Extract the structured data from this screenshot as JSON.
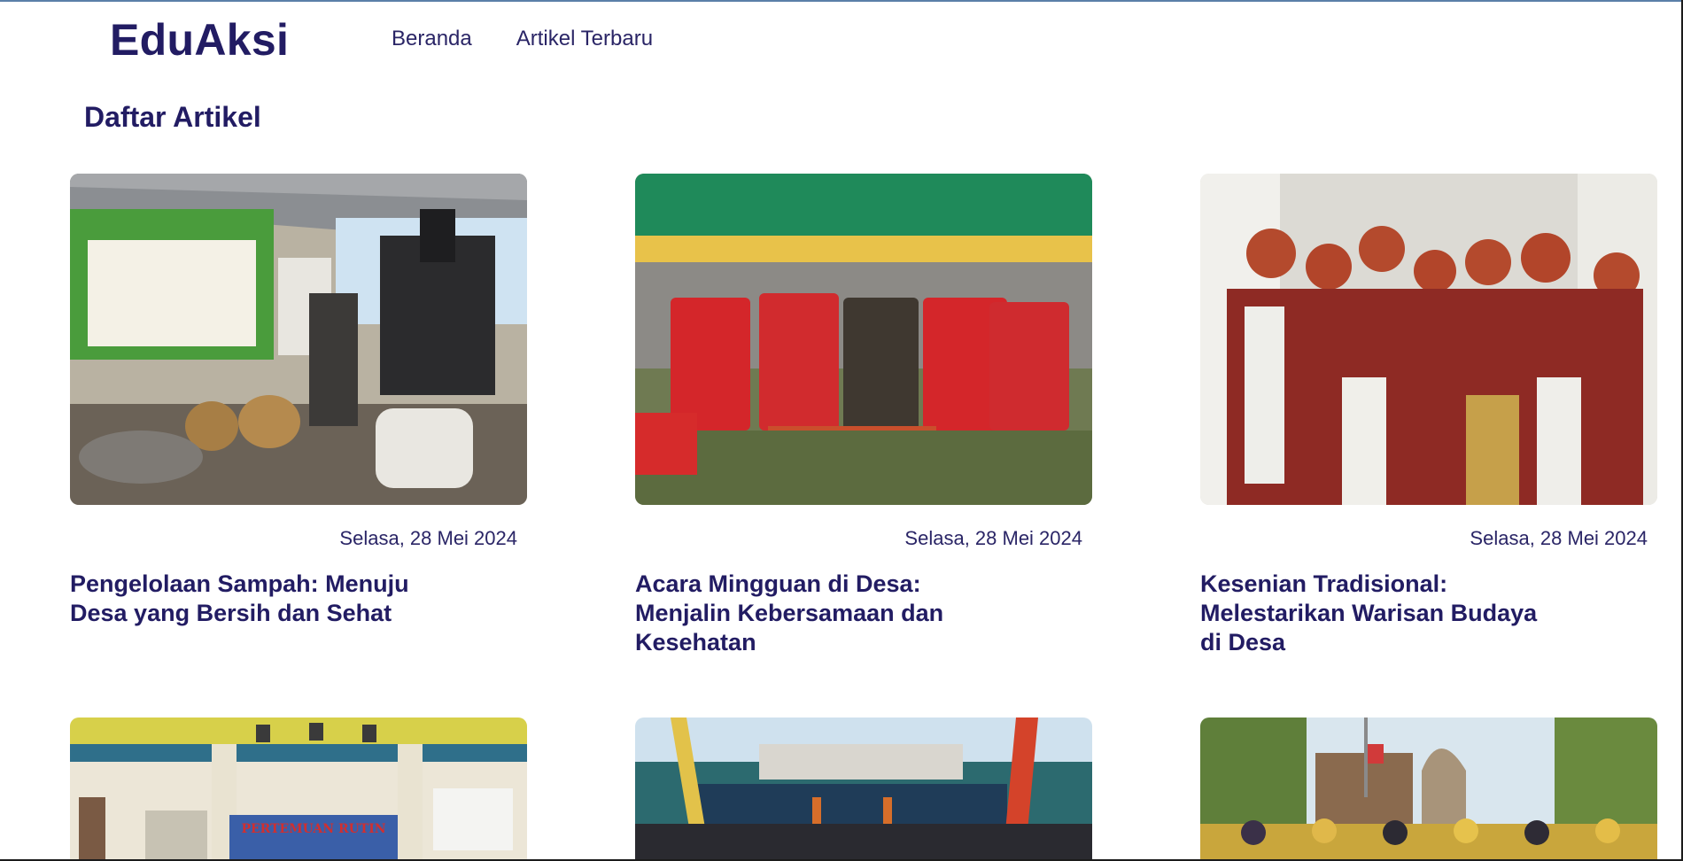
{
  "app": {
    "brand": "EduAksi",
    "nav": [
      {
        "label": "Beranda"
      },
      {
        "label": "Artikel Terbaru"
      }
    ]
  },
  "main": {
    "section_title": "Daftar Artikel",
    "articles": [
      {
        "date": "Selasa, 28 Mei 2024",
        "title": "Pengelolaan Sampah: Menuju Desa yang Bersih dan Sehat"
      },
      {
        "date": "Selasa, 28 Mei 2024",
        "title": "Acara Mingguan di Desa: Menjalin Kebersamaan dan Kesehatan"
      },
      {
        "date": "Selasa, 28 Mei 2024",
        "title": "Kesenian Tradisional: Melestarikan Warisan Budaya di Desa"
      },
      {
        "banner_text": "PERTEMUAN RUTIN"
      },
      {},
      {}
    ]
  },
  "colors": {
    "brand": "#221c63",
    "text": "#2a2566"
  }
}
